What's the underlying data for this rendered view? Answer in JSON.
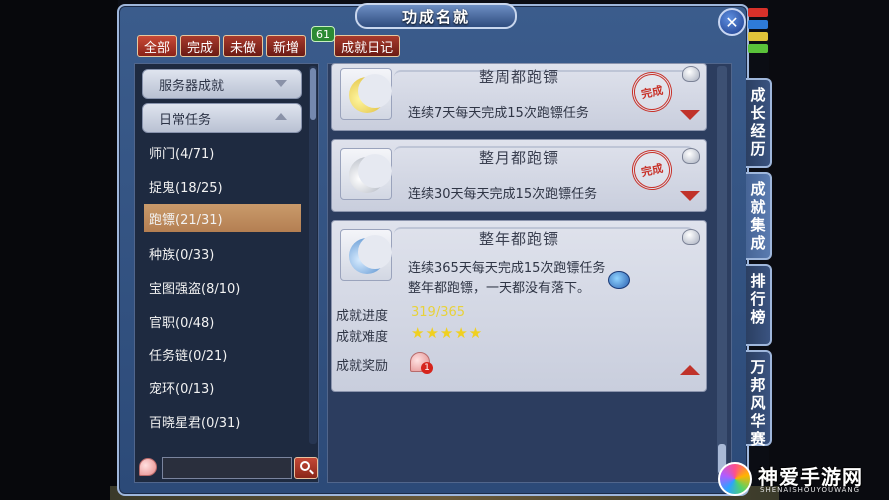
{
  "window": {
    "title": "功成名就",
    "close_label": "✕"
  },
  "tabs": [
    {
      "label": "全部"
    },
    {
      "label": "完成"
    },
    {
      "label": "未做"
    },
    {
      "label": "新增"
    },
    {
      "label": "成就日记"
    }
  ],
  "new_badge": "61",
  "categories": [
    {
      "label": "服务器成就"
    },
    {
      "label": "日常任务"
    }
  ],
  "sub_items": [
    {
      "label": "师门(4/71)"
    },
    {
      "label": "捉鬼(18/25)"
    },
    {
      "label": "跑镖(21/31)"
    },
    {
      "label": "种族(0/33)"
    },
    {
      "label": "宝图强盗(8/10)"
    },
    {
      "label": "官职(0/48)"
    },
    {
      "label": "任务链(0/21)"
    },
    {
      "label": "宠环(0/13)"
    },
    {
      "label": "百晓星君(0/31)"
    }
  ],
  "search": {
    "value": ""
  },
  "achievements": [
    {
      "name": "整周都跑镖",
      "desc": "连续7天每天完成15次跑镖任务",
      "seal": "完成"
    },
    {
      "name": "整月都跑镖",
      "desc": "连续30天每天完成15次跑镖任务",
      "seal": "完成"
    },
    {
      "name": "整年都跑镖",
      "desc": "连续365天每天完成15次跑镖任务",
      "desc2": "整年都跑镖，一天都没有落下。",
      "progress_label": "成就进度",
      "progress_value": "319/365",
      "difficulty_label": "成就难度",
      "difficulty_stars": "★★★★★",
      "reward_label": "成就奖励",
      "reward_count": "1"
    }
  ],
  "side_tabs": [
    {
      "label": "成长经历"
    },
    {
      "label": "成就集成"
    },
    {
      "label": "排行榜"
    },
    {
      "label": "万邦风华赛"
    }
  ],
  "watermark": {
    "text": "神爱手游网",
    "sub": "SHENAISHOUYOUWANG"
  },
  "colors": {
    "accent_red": "#c0322a",
    "progress_yellow": "#f2e64a",
    "selected_item": "#c99a6b"
  }
}
